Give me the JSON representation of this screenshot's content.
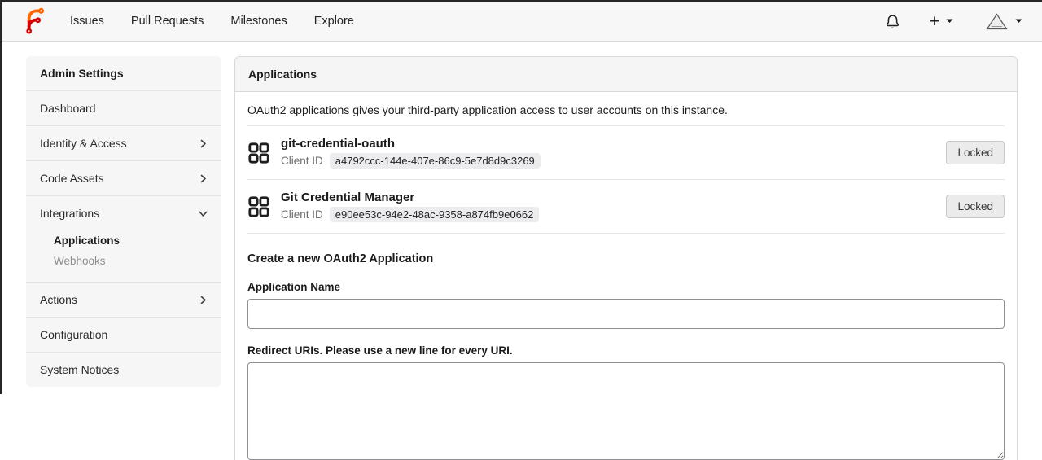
{
  "topnav": {
    "items": [
      {
        "label": "Issues"
      },
      {
        "label": "Pull Requests"
      },
      {
        "label": "Milestones"
      },
      {
        "label": "Explore"
      }
    ]
  },
  "sidebar": {
    "title": "Admin Settings",
    "items": [
      {
        "label": "Dashboard",
        "chevron": "none"
      },
      {
        "label": "Identity & Access",
        "chevron": "right"
      },
      {
        "label": "Code Assets",
        "chevron": "right"
      },
      {
        "label": "Integrations",
        "chevron": "down"
      },
      {
        "label": "Actions",
        "chevron": "right"
      },
      {
        "label": "Configuration",
        "chevron": "none"
      },
      {
        "label": "System Notices",
        "chevron": "none"
      }
    ],
    "submenu": [
      {
        "label": "Applications",
        "active": true
      },
      {
        "label": "Webhooks",
        "active": false
      }
    ]
  },
  "main": {
    "panel_title": "Applications",
    "description": "OAuth2 applications gives your third-party application access to user accounts on this instance.",
    "client_id_label": "Client ID",
    "locked_label": "Locked",
    "apps": [
      {
        "name": "git-credential-oauth",
        "client_id": "a4792ccc-144e-407e-86c9-5e7d8d9c3269"
      },
      {
        "name": "Git Credential Manager",
        "client_id": "e90ee53c-94e2-48ac-9358-a874fb9e0662"
      }
    ],
    "create": {
      "heading": "Create a new OAuth2 Application",
      "app_name_label": "Application Name",
      "redirect_label": "Redirect URIs. Please use a new line for every URI.",
      "app_name_value": "",
      "redirect_value": ""
    }
  },
  "colors": {
    "brand_orange": "#ff6600",
    "brand_red": "#d40000"
  }
}
